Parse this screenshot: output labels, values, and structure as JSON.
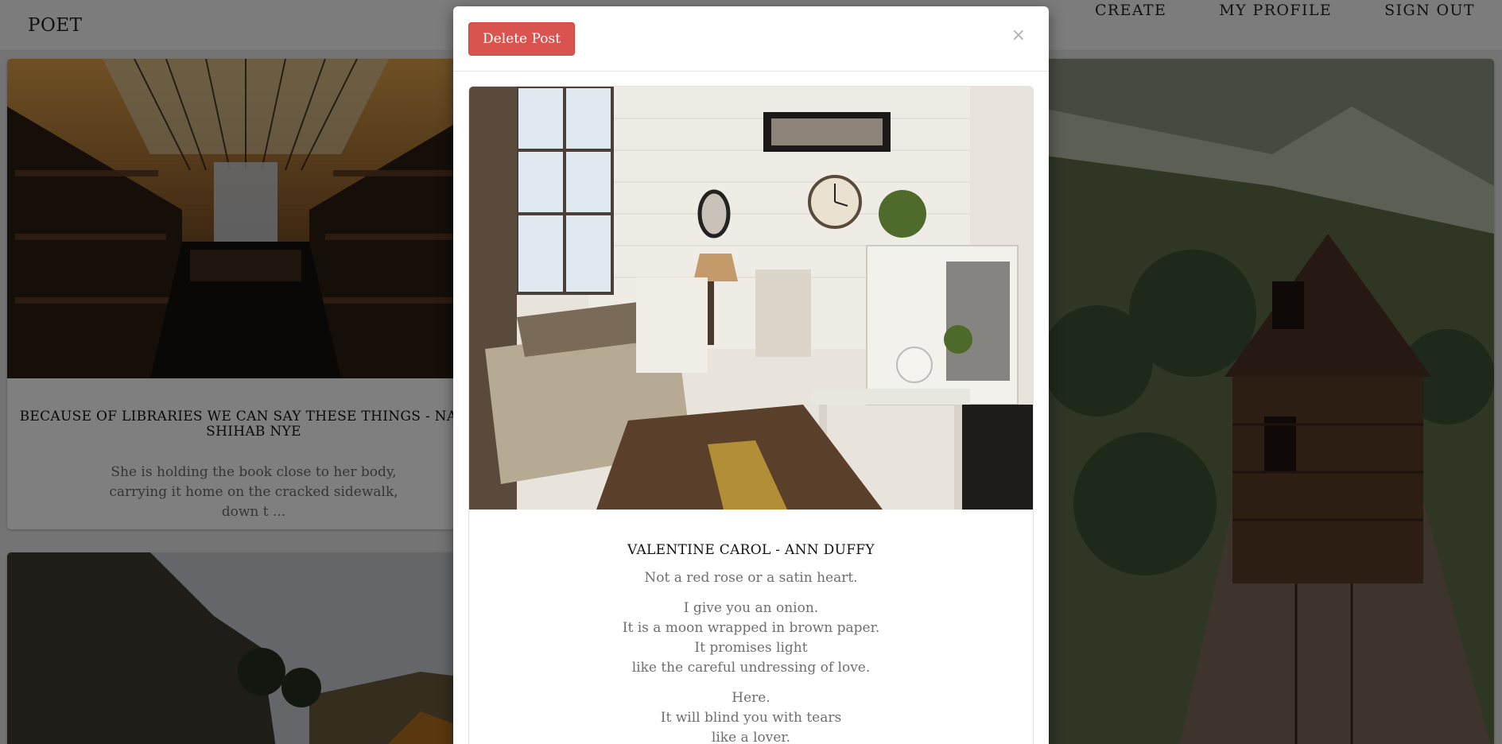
{
  "navbar": {
    "brand": "POET",
    "links": [
      "CREATE",
      "MY PROFILE",
      "SIGN OUT"
    ]
  },
  "cards": [
    {
      "title": "BECAUSE OF LIBRARIES WE CAN SAY THESE THINGS - NAOMI SHIHAB NYE",
      "excerpt": "She is holding the book close to her body, carrying it home on the cracked sidewalk, down t ..."
    }
  ],
  "modal": {
    "delete_label": "Delete Post",
    "close_glyph": "×",
    "post": {
      "title": "VALENTINE CAROL - ANN DUFFY",
      "stanzas": [
        [
          "Not a red rose or a satin heart."
        ],
        [
          "I give you an onion.",
          "It is a moon wrapped in brown paper.",
          "It promises light",
          "like the careful undressing of love."
        ],
        [
          "Here.",
          "It will blind you with tears",
          "like a lover."
        ]
      ]
    }
  },
  "colors": {
    "danger": "#d9534f",
    "overlay": "rgba(0,0,0,0.5)"
  },
  "icons": {
    "close": "close-icon"
  }
}
